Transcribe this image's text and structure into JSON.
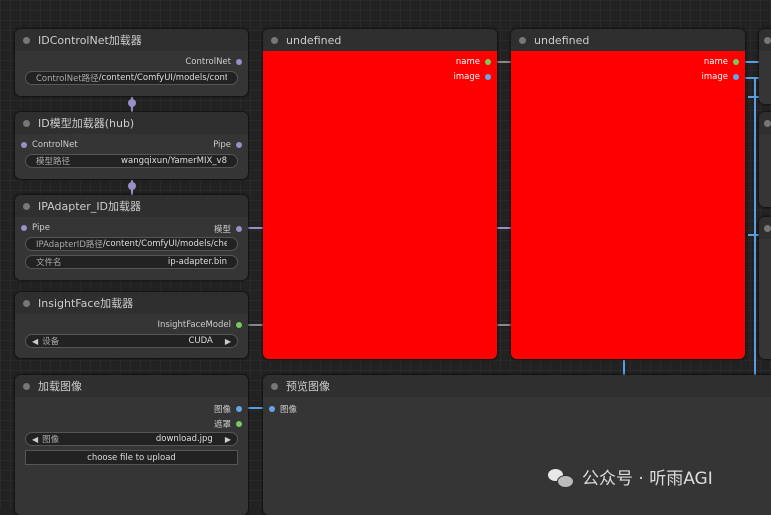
{
  "colors": {
    "background": "#222222",
    "node_body": "#353535",
    "node_header": "#2f2f2f",
    "preview_red": "#ff0000",
    "pin_purple": "#9a8fc9",
    "pin_green": "#7ac95e",
    "pin_blue": "#64a8ea",
    "wire_blue": "#5aa0e0"
  },
  "nodes": {
    "idcontrolnet_loader": {
      "title": "IDControlNet加载器",
      "output": "ControlNet",
      "widget_label": "ControlNet路径",
      "widget_value": "/content/ComfyUI/models/contro"
    },
    "idmodel_loader": {
      "title": "ID模型加载器(hub)",
      "input": "ControlNet",
      "output": "Pipe",
      "widget_label": "模型路径",
      "widget_value": "wangqixun/YamerMIX_v8"
    },
    "ipadapter_loader": {
      "title": "IPAdapter_ID加载器",
      "input": "Pipe",
      "output": "模型",
      "widget1_label": "IPAdapterID路径",
      "widget1_value": "/content/ComfyUI/models/checkp",
      "widget2_label": "文件名",
      "widget2_value": "ip-adapter.bin"
    },
    "insightface_loader": {
      "title": "InsightFace加载器",
      "output": "InsightFaceModel",
      "combo_label": "设备",
      "combo_value": "CUDA",
      "arrow_left": "◀",
      "arrow_right": "▶"
    },
    "load_image": {
      "title": "加载图像",
      "output1": "图像",
      "output2": "遮罩",
      "combo_label": "图像",
      "combo_value": "download.jpg",
      "arrow_left": "◀",
      "arrow_right": "▶",
      "upload_label": "choose file to upload"
    },
    "undefined_1": {
      "title": "undefined",
      "output1": "name",
      "output2": "image"
    },
    "undefined_2": {
      "title": "undefined",
      "output1": "name",
      "output2": "image"
    },
    "preview_image": {
      "title": "预览图像",
      "input": "图像"
    }
  },
  "watermark": {
    "icon": "wechat-icon",
    "text": "公众号 · 听雨AGI"
  }
}
